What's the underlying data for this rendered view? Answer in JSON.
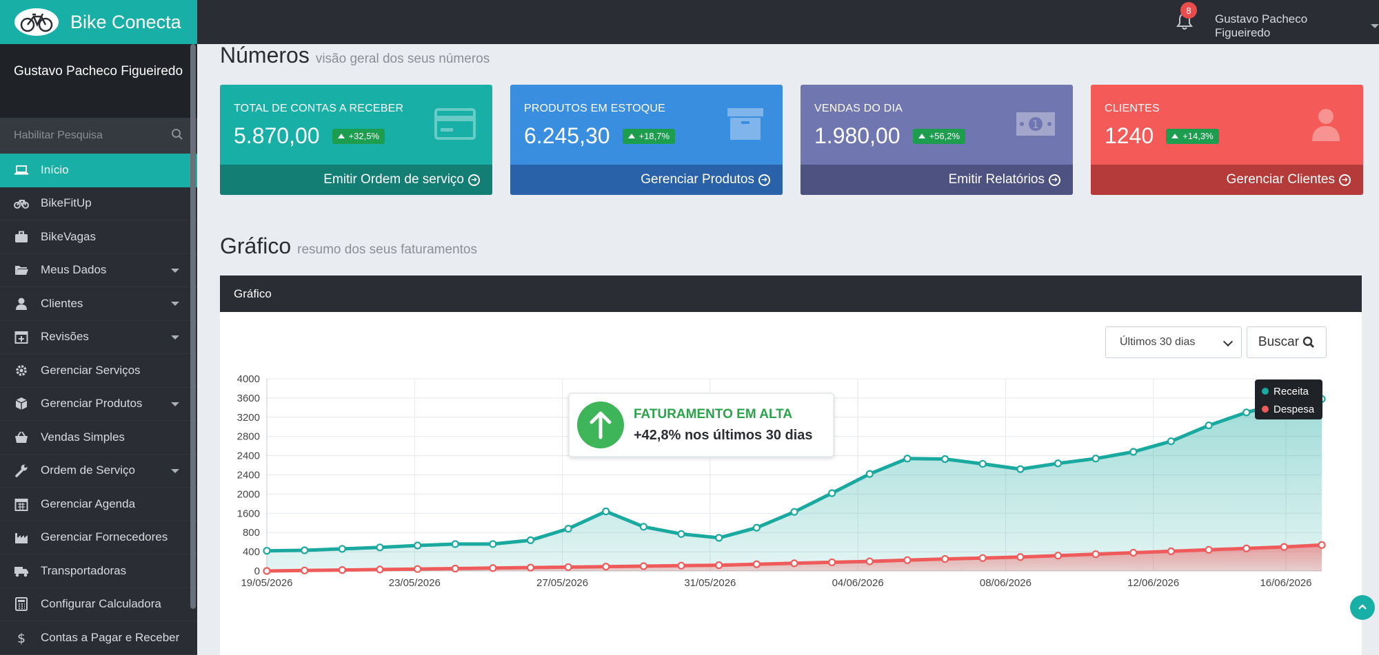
{
  "app": {
    "brand": "Bike Conecta",
    "user_name": "Gustavo Pacheco Figueiredo",
    "notifications": "8"
  },
  "sidebar": {
    "user_name": "Gustavo Pacheco Figueiredo",
    "search_label": "Habilitar Pesquisa",
    "items": [
      {
        "label": "Início",
        "icon": "laptop-icon",
        "active": true
      },
      {
        "label": "BikeFitUp",
        "icon": "bicycle-icon"
      },
      {
        "label": "BikeVagas",
        "icon": "briefcase-icon"
      },
      {
        "label": "Meus Dados",
        "icon": "folder-open-icon",
        "has_submenu": true
      },
      {
        "label": "Clientes",
        "icon": "user-icon",
        "has_submenu": true
      },
      {
        "label": "Revisões",
        "icon": "calendar-plus-icon",
        "has_submenu": true
      },
      {
        "label": "Gerenciar Serviços",
        "icon": "gear-icon"
      },
      {
        "label": "Gerenciar Produtos",
        "icon": "cube-icon",
        "has_submenu": true
      },
      {
        "label": "Vendas Simples",
        "icon": "basket-icon"
      },
      {
        "label": "Ordem de Serviço",
        "icon": "wrench-icon",
        "has_submenu": true
      },
      {
        "label": "Gerenciar Agenda",
        "icon": "calendar-icon"
      },
      {
        "label": "Gerenciar Fornecedores",
        "icon": "industry-icon"
      },
      {
        "label": "Transportadoras",
        "icon": "truck-icon"
      },
      {
        "label": "Configurar Calculadora",
        "icon": "calculator-icon"
      },
      {
        "label": "Contas a Pagar e Receber",
        "icon": "dollar-icon"
      }
    ]
  },
  "numbers": {
    "title": "Números",
    "subtitle": "visão geral dos seus números"
  },
  "cards": [
    {
      "label": "TOTAL DE CONTAS A RECEBER",
      "value": "5.870,00",
      "change": "+32,5%",
      "link": "Emitir Ordem de serviço",
      "color": "#18b0a6",
      "footer_color": "#137e73",
      "icon": "credit-card-icon"
    },
    {
      "label": "PRODUTOS EM ESTOQUE",
      "value": "6.245,30",
      "change": "+18,7%",
      "link": "Gerenciar Produtos",
      "color": "#3a8ee0",
      "footer_color": "#2962a8",
      "icon": "archive-icon"
    },
    {
      "label": "VENDAS DO DIA",
      "value": "1.980,00",
      "change": "+56,2%",
      "link": "Emitir Relatórios",
      "color": "#7077b0",
      "footer_color": "#4d5281",
      "icon": "money-icon"
    },
    {
      "label": "CLIENTES",
      "value": "1240",
      "change": "+14,3%",
      "link": "Gerenciar Clientes",
      "color": "#f45a58",
      "footer_color": "#b53b3a",
      "icon": "user-icon"
    }
  ],
  "grafico": {
    "title": "Gráfico",
    "subtitle": "resumo dos seus faturamentos",
    "panel_title": "Gráfico",
    "period_select": "Últimos 30 dias",
    "search_button": "Buscar",
    "callout_title": "FATURAMENTO EM ALTA",
    "callout_text": "+42,8% nos últimos 30 dias"
  },
  "chart_data": {
    "type": "area",
    "x_ticks": [
      "19/05/2026",
      "23/05/2026",
      "27/05/2026",
      "31/05/2026",
      "04/06/2026",
      "08/06/2026",
      "12/06/2026",
      "16/06/2026"
    ],
    "y_ticks": [
      "0",
      "400",
      "800",
      "1600",
      "2000",
      "2400",
      "2400",
      "2800",
      "3200",
      "3600",
      "4000"
    ],
    "ylim": [
      0,
      4000
    ],
    "x_days": [
      0,
      1,
      2,
      3,
      4,
      5,
      6,
      7,
      8,
      9,
      10,
      11,
      12,
      13,
      14,
      15,
      16,
      17,
      18,
      19,
      20,
      21,
      22,
      23,
      24,
      25,
      26,
      27,
      28
    ],
    "series": [
      {
        "name": "Receita",
        "color": "#1aa99f",
        "values": [
          420,
          430,
          460,
          490,
          530,
          560,
          560,
          640,
          880,
          1240,
          920,
          770,
          690,
          900,
          1230,
          1620,
          2020,
          2340,
          2330,
          2230,
          2120,
          2240,
          2340,
          2480,
          2700,
          3030,
          3300,
          3500,
          3580
        ]
      },
      {
        "name": "Despesa",
        "color": "#ef5b5b",
        "values": [
          0,
          10,
          20,
          30,
          40,
          50,
          60,
          70,
          80,
          90,
          100,
          110,
          120,
          140,
          160,
          180,
          200,
          225,
          250,
          270,
          290,
          320,
          350,
          380,
          410,
          440,
          470,
          500,
          540
        ]
      }
    ],
    "legend_position": "top-right",
    "grid": true
  }
}
